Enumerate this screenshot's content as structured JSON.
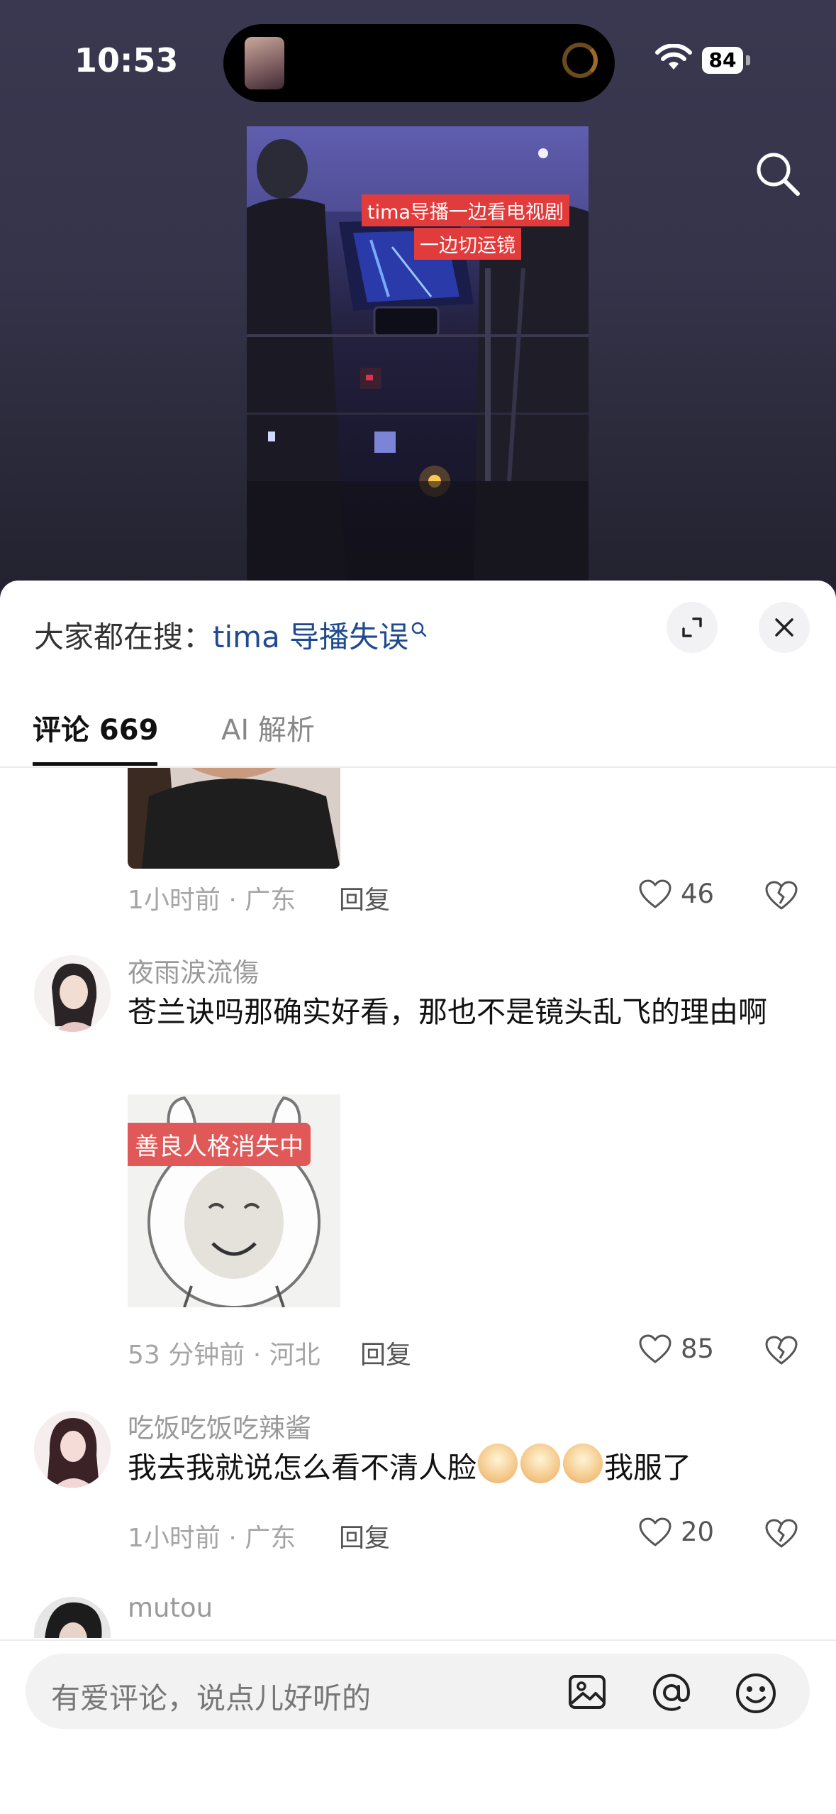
{
  "status_bar": {
    "time": "10:53",
    "battery": "84"
  },
  "video": {
    "caption_line1": "tima导播一边看电视剧",
    "caption_line2": "一边切运镜"
  },
  "sheet": {
    "trend_prefix": "大家都在搜：",
    "trend_keyword": "tima 导播失误",
    "tabs": {
      "comments_label": "评论 669",
      "ai_label": "AI 解析"
    }
  },
  "comments": [
    {
      "meta": "1小时前 · 广东",
      "reply": "回复",
      "likes": "46"
    },
    {
      "username": "夜雨涙流傷",
      "text": "苍兰诀吗那确实好看，那也不是镜头乱飞的理由啊",
      "image_text": "善良人格消失中",
      "meta": "53 分钟前 · 河北",
      "reply": "回复",
      "likes": "85"
    },
    {
      "username": "吃饭吃饭吃辣酱",
      "text_before": "我去我就说怎么看不清人脸",
      "text_after": "我服了",
      "meta": "1小时前 · 广东",
      "reply": "回复",
      "likes": "20"
    },
    {
      "username": "mutou"
    }
  ],
  "input": {
    "placeholder": "有爱评论，说点儿好听的"
  }
}
